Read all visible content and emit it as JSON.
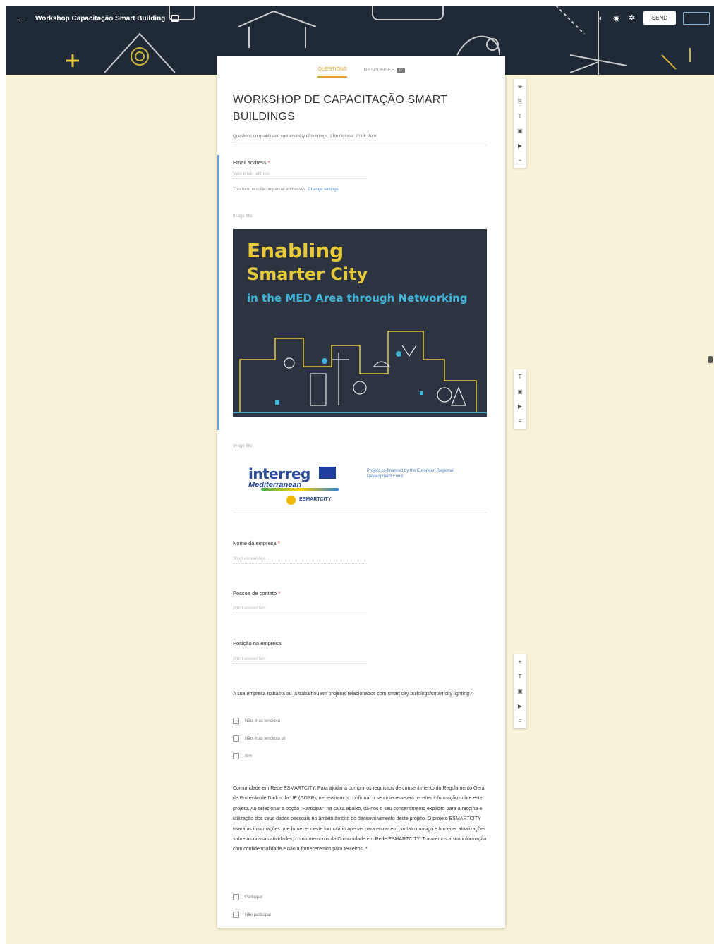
{
  "colors": {
    "page_bg": "#f8f2d8",
    "banner_bg": "#1f2a36",
    "accent": "#e0a030",
    "poster_yellow": "#e8c93a",
    "poster_blue": "#3fb4d8"
  },
  "topbar": {
    "back_icon": "arrow-left-icon",
    "title": "Workshop Capacitação Smart Building",
    "send_label": "SEND"
  },
  "tabs": {
    "questions": "QUESTIONS",
    "responses": "RESPONSES",
    "responses_count": "0"
  },
  "form": {
    "title": "WORKSHOP DE CAPACITAÇÃO SMART BUILDINGS",
    "description": "Questions on quality and sustainability of buildings, 17th October 2019, Porto",
    "email": {
      "label": "Email address",
      "required": "*",
      "placeholder": "Valid email address",
      "note": "This form is collecting email addresses.",
      "note_link": "Change settings"
    },
    "image1_label": "Image title",
    "poster": {
      "line1": "Enabling",
      "line2": "Smarter City",
      "line3": "in the MED Area through Networking"
    },
    "image2_label": "Image title",
    "logos": {
      "interreg": "interreg",
      "mediterranean": "Mediterranean",
      "esmartcity": "ESMARTCITY",
      "erdf": "Project co-financed by the European Regional Development Fund"
    },
    "q_company": {
      "label": "Nome da empresa",
      "required": "*",
      "placeholder": "Short answer text"
    },
    "q_contact": {
      "label": "Pessoa de contato",
      "required": "*",
      "placeholder": "Short answer text"
    },
    "q_position": {
      "label": "Posição na empresa",
      "placeholder": "Short answer text"
    },
    "q_projects": {
      "label": "A sua empresa trabalha ou já trabalhou em projetos relacionados com smart city buildings/smart city lighting?",
      "options": [
        "Não, mas tenciona",
        "Não, mas tenciona vir",
        "Sim"
      ]
    },
    "q_consent": {
      "label": "Comunidade em Rede ESMARTCITY. Para ajudar a cumprir os requisitos de consentimento do Regulamento Geral de Proteção de Dados da UE (GDPR), necessitamos confirmar o seu interesse em receber informação sobre este projeto. Ao selecionar a opção \"Participar\" na caixa abaixo, dá-nos o seu consentimento explícito para a recolha e utilização dos seus dados pessoais no âmbito âmbito do desenvolvimento deste projeto. O projeto ESMARTCITY usará as informações que fornecer neste formulário apenas para entrar em contato consigo e fornecer atualizações sobre as nossas atividades, como membros da Comunidade em Rede ESMARTCITY. Trataremos a sua informação com confidencialidade e não a forneceremos para terceiros.",
      "required": "*",
      "options": [
        "Participar",
        "Não participar"
      ]
    }
  },
  "side_tools": {
    "group1": [
      "add-circle-icon",
      "import-icon",
      "title-icon",
      "image-icon",
      "video-icon",
      "section-icon"
    ],
    "group2": [
      "title-icon",
      "image-icon",
      "video-icon",
      "section-icon"
    ],
    "group3": [
      "add-icon",
      "title-icon",
      "image-icon",
      "video-icon",
      "section-icon"
    ]
  }
}
